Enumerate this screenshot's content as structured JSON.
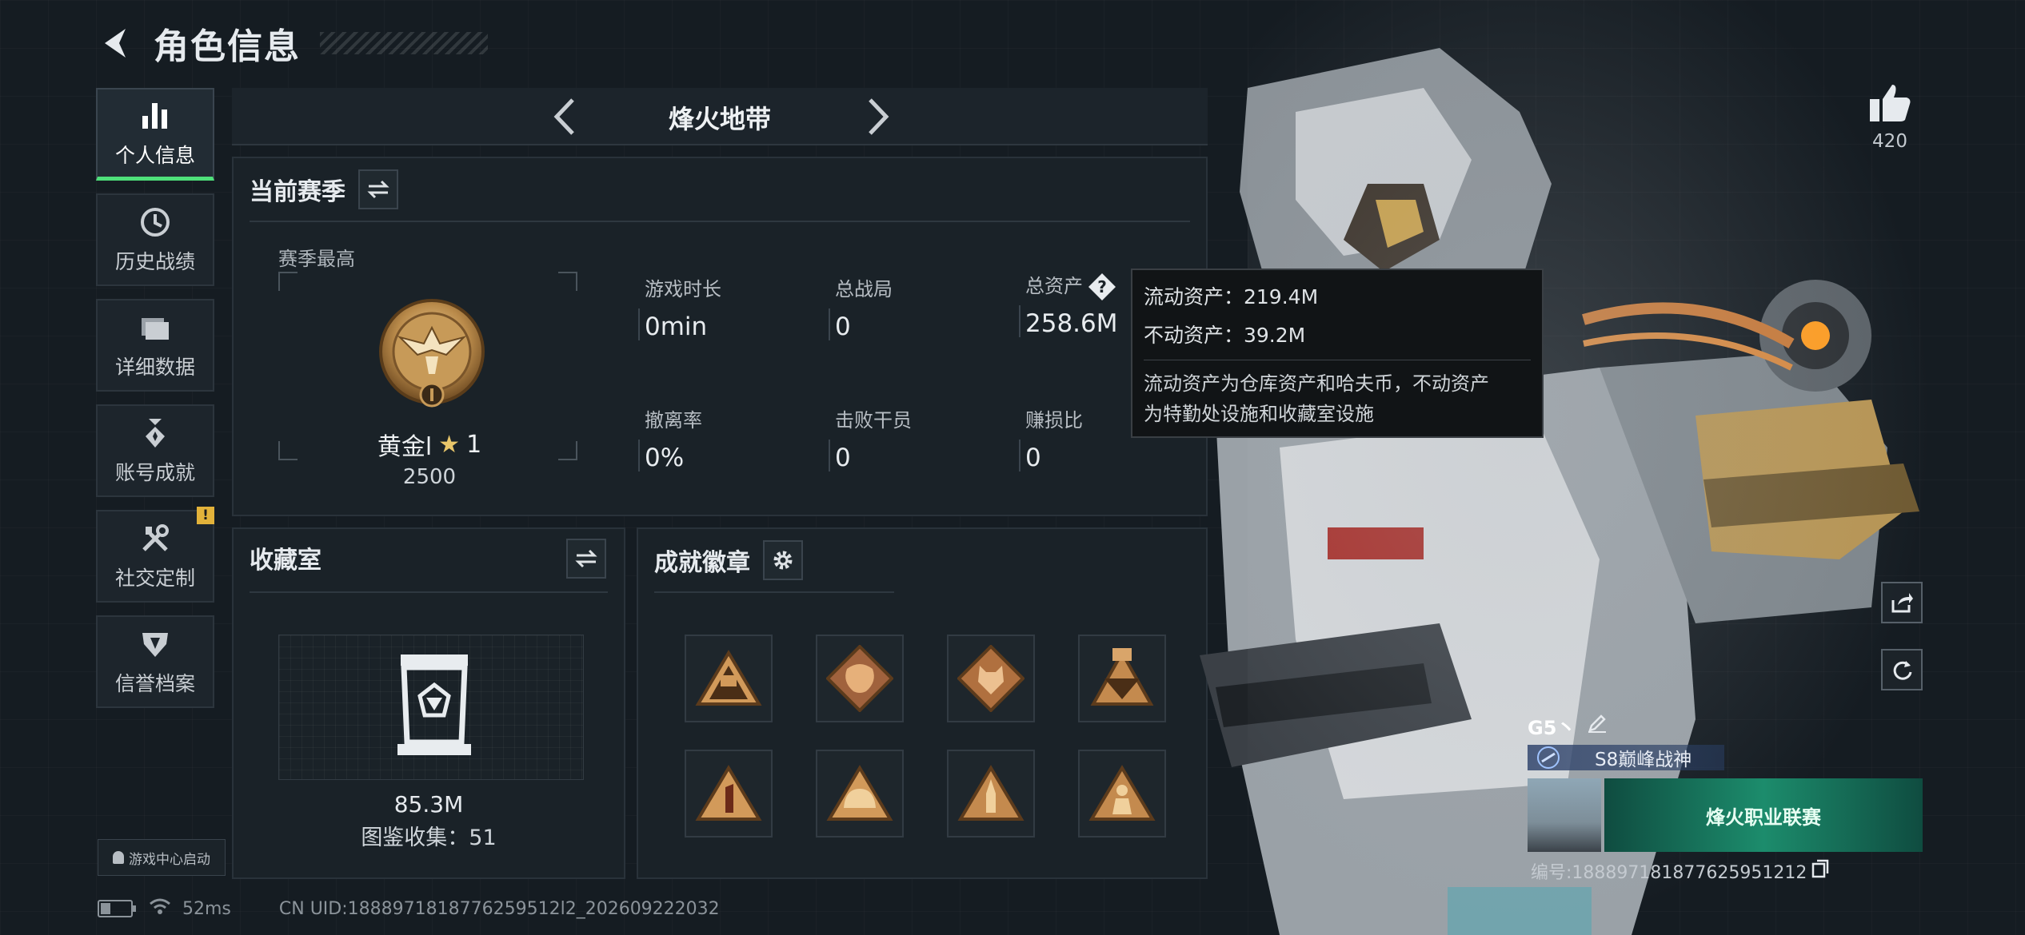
{
  "header": {
    "title": "角色信息"
  },
  "sidebar": {
    "items": [
      {
        "label": "个人信息",
        "icon": "bar-chart-icon",
        "active": true
      },
      {
        "label": "历史战绩",
        "icon": "clock-icon"
      },
      {
        "label": "详细数据",
        "icon": "folders-icon"
      },
      {
        "label": "账号成就",
        "icon": "medal-icon"
      },
      {
        "label": "社交定制",
        "icon": "tools-icon",
        "alert": "!"
      },
      {
        "label": "信誉档案",
        "icon": "shield-icon"
      }
    ],
    "launch_label": "游戏中心启动"
  },
  "footer": {
    "ping": "52ms",
    "uid": "CN UID:1888971818776259512l2_202609222032"
  },
  "mode": {
    "title": "烽火地带"
  },
  "season": {
    "title": "当前赛季",
    "subtitle": "赛季最高",
    "rank_name": "黄金l",
    "rank_stars": "1",
    "rank_score": "2500",
    "stats": [
      {
        "label": "游戏时长",
        "value": "0min"
      },
      {
        "label": "总战局",
        "value": "0"
      },
      {
        "label": "总资产",
        "value": "258.6M"
      },
      {
        "label": "撤离率",
        "value": "0%"
      },
      {
        "label": "击败干员",
        "value": "0"
      },
      {
        "label": "赚损比",
        "value": "0"
      }
    ]
  },
  "tooltip": {
    "liquid": "流动资产：219.4M",
    "fixed": "不动资产：39.2M",
    "desc_1": "流动资产为仓库资产和哈夫币，不动资产",
    "desc_2": "为特勤处设施和收藏室设施"
  },
  "collection": {
    "title": "收藏室",
    "value": "85.3M",
    "count": "图鉴收集：51"
  },
  "achievements": {
    "title": "成就徽章",
    "badges": [
      "badge-s8-triangle",
      "badge-dragon-diamond",
      "badge-wolf-diamond",
      "badge-s8-emblem",
      "badge-number-1",
      "badge-helmet",
      "badge-rocket",
      "badge-soldier"
    ]
  },
  "likes": {
    "count": "420"
  },
  "player": {
    "name": "G5丶",
    "title": "S8巅峰战神",
    "banner_text": "烽火职业联赛",
    "id": "编号:188897181877625951212"
  },
  "colors": {
    "accent": "#4ee07a",
    "gold": "#c8964a",
    "warn": "#e2b23a"
  }
}
